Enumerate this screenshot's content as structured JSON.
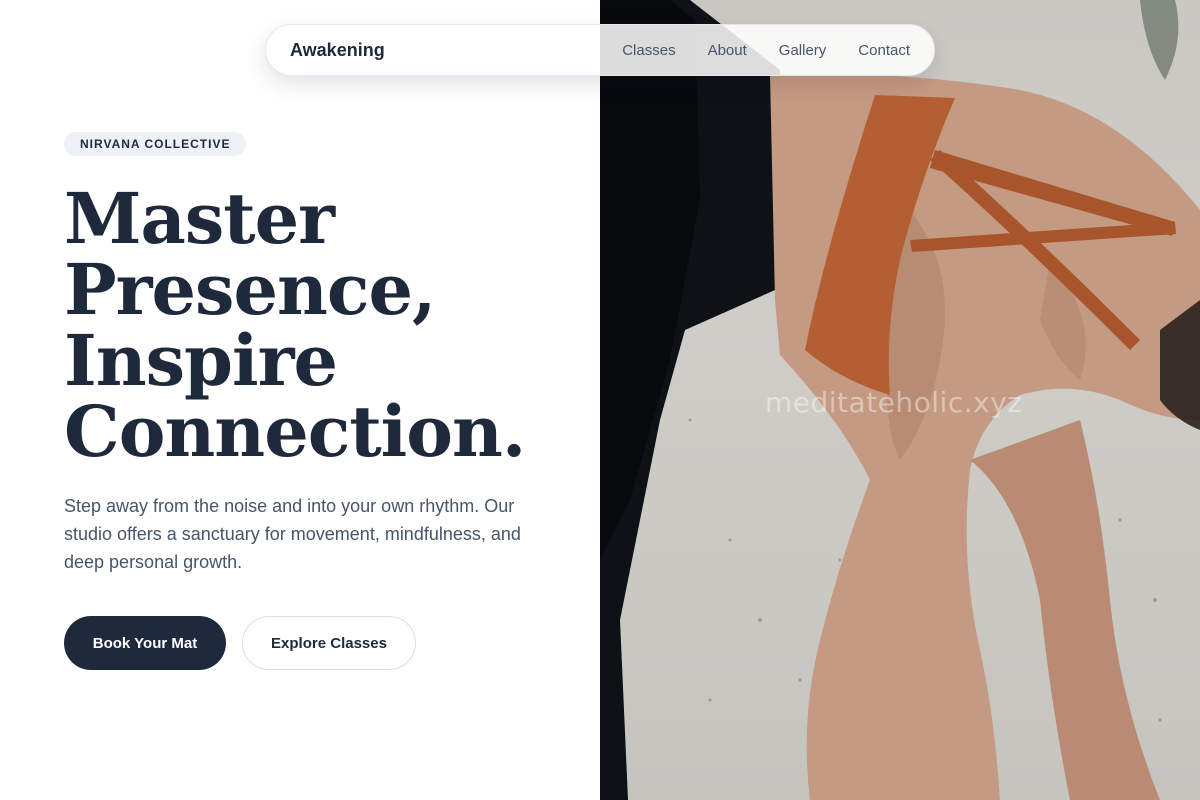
{
  "nav": {
    "brand": "Awakening",
    "links": [
      "Classes",
      "About",
      "Gallery",
      "Contact"
    ]
  },
  "hero": {
    "badge": "NIRVANA COLLECTIVE",
    "headline": [
      "Master",
      "Presence,",
      "Inspire",
      "Connection."
    ],
    "lede": "Step away from the noise and into your own rhythm. Our studio offers a sanctuary for movement, mindfulness, and deep personal growth.",
    "primary_cta": "Book Your Mat",
    "secondary_cta": "Explore Classes"
  },
  "photo": {
    "watermark": "meditateholic.xyz",
    "subject": "yoga-pose-photo"
  },
  "colors": {
    "ink": "#1e293b",
    "muted": "#475569",
    "badge_bg": "#eef2f7",
    "top_rust": "#b35f33"
  }
}
